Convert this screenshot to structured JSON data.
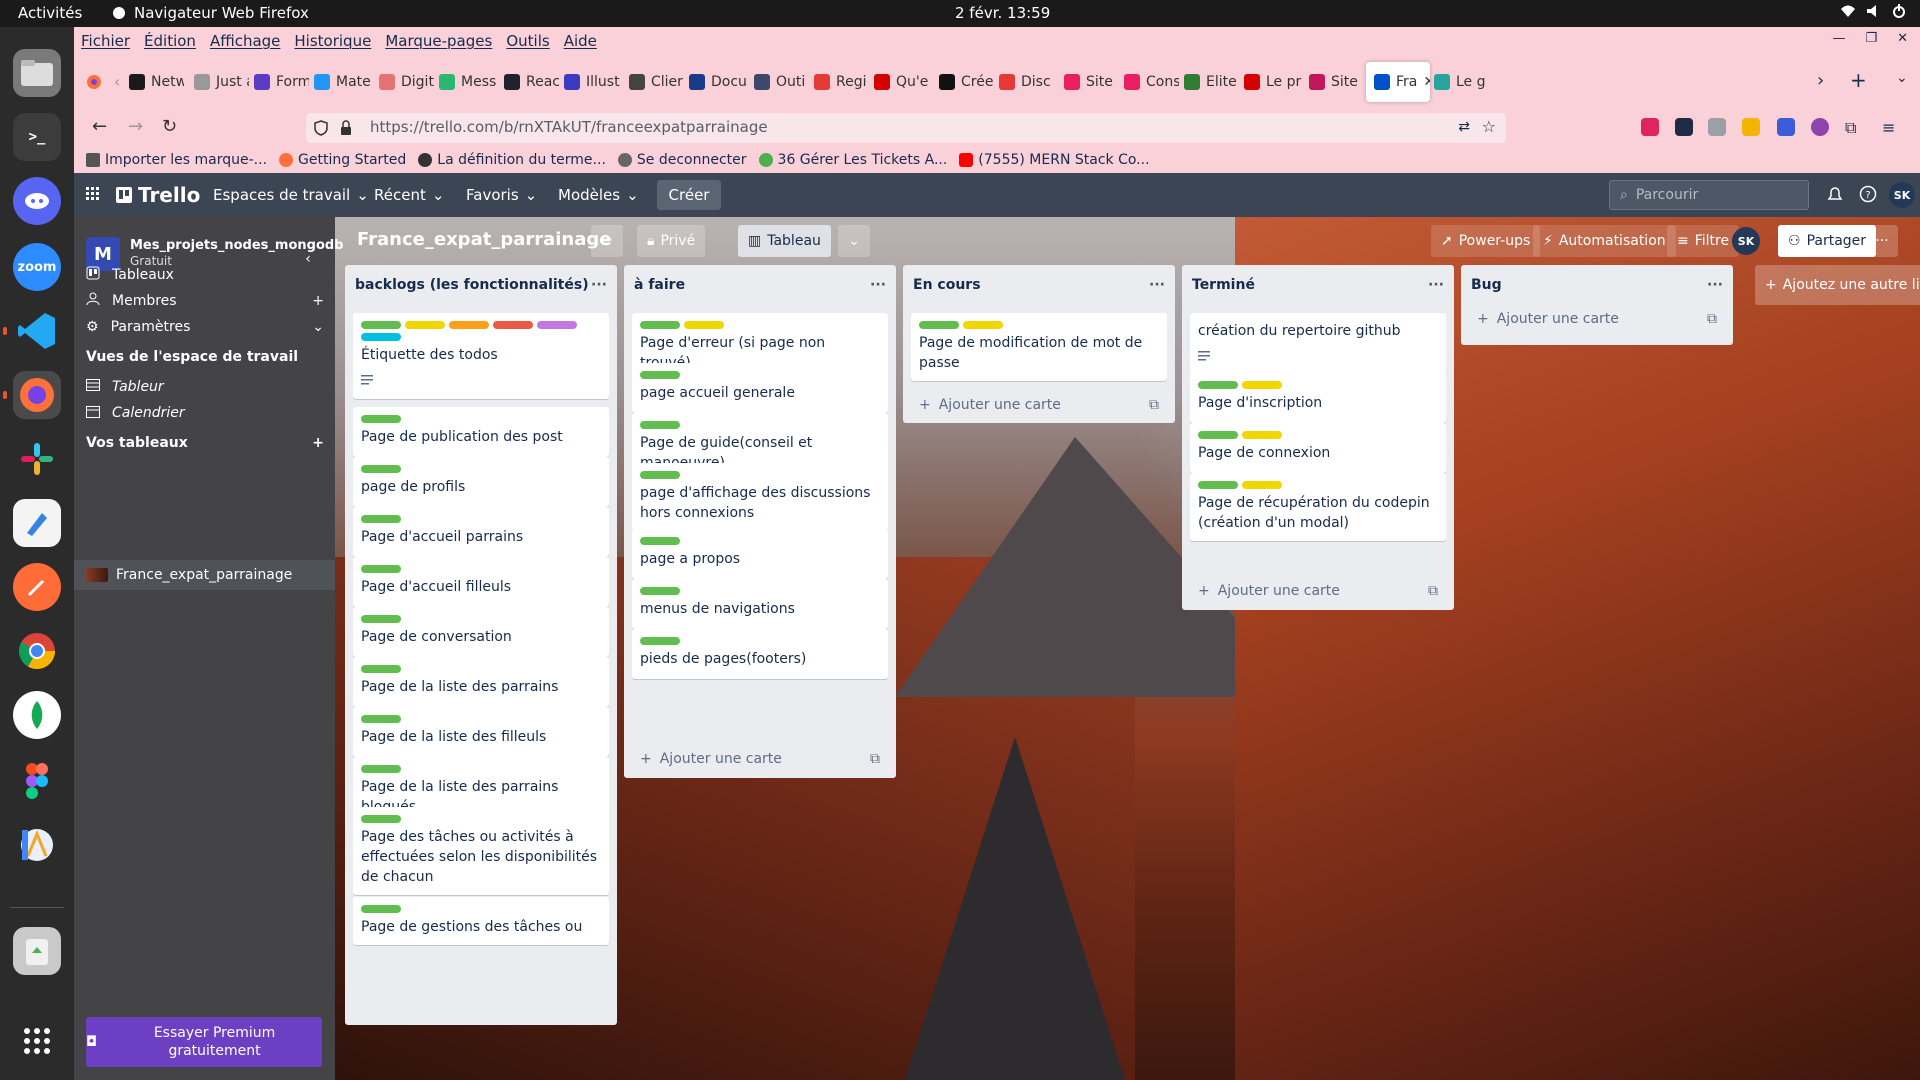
{
  "os": {
    "activities": "Activités",
    "app_name": "Navigateur Web Firefox",
    "clock": "2 févr.  13:59",
    "dock_apps": [
      "files",
      "terminal",
      "discord",
      "zoom",
      "vscode",
      "firefox",
      "slack",
      "text-editor",
      "postman",
      "chrome",
      "mongodb-compass",
      "figma",
      "android-studio",
      "trash",
      "app-grid"
    ]
  },
  "firefox": {
    "menu": [
      "Fichier",
      "Édition",
      "Affichage",
      "Historique",
      "Marque-pages",
      "Outils",
      "Aide"
    ],
    "tabs": [
      {
        "title": "Netw",
        "color": "#1a1a1a"
      },
      {
        "title": "Just a m",
        "color": "#999999"
      },
      {
        "title": "Form",
        "color": "#5b3cc4"
      },
      {
        "title": "Mate",
        "color": "#2196f3"
      },
      {
        "title": "Digit",
        "color": "#e57373"
      },
      {
        "title": "Mess",
        "color": "#2bb673"
      },
      {
        "title": "Reac",
        "color": "#20232a"
      },
      {
        "title": "Illust",
        "color": "#3b3bbf"
      },
      {
        "title": "Clier",
        "color": "#444444"
      },
      {
        "title": "Docu",
        "color": "#1b3a8a"
      },
      {
        "title": "Outi",
        "color": "#3b4a6b"
      },
      {
        "title": "Regi",
        "color": "#e53935"
      },
      {
        "title": "Qu'e",
        "color": "#d50000"
      },
      {
        "title": "Crée",
        "color": "#111111"
      },
      {
        "title": "Disc",
        "color": "#e53935"
      },
      {
        "title": "Site",
        "color": "#e91e63"
      },
      {
        "title": "Cons",
        "color": "#e91e63"
      },
      {
        "title": "Elite",
        "color": "#2e7d32"
      },
      {
        "title": "Le pr",
        "color": "#d50000"
      },
      {
        "title": "Site",
        "color": "#c2185b"
      },
      {
        "title": "Fra",
        "color": "#0052cc",
        "active": true
      },
      {
        "title": "Le g",
        "color": "#26a69a"
      }
    ],
    "url": "https://trello.com/b/rnXTAkUT/franceexpatparrainage",
    "bookmarks": [
      {
        "label": "Importer les marque-...",
        "color": "#555555"
      },
      {
        "label": "Getting Started",
        "color": "#ff7139"
      },
      {
        "label": "La définition du terme...",
        "color": "#333333"
      },
      {
        "label": "Se deconnecter",
        "color": "#666666"
      },
      {
        "label": "36 Gérer Les Tickets A...",
        "color": "#4caf50"
      },
      {
        "label": "(7555) MERN Stack Co...",
        "color": "#ff0000"
      }
    ]
  },
  "trello": {
    "logo": "Trello",
    "menus": [
      "Espaces de travail",
      "Récent",
      "Favoris",
      "Modèles"
    ],
    "create": "Créer",
    "search_placeholder": "Parcourir",
    "avatar": "SK",
    "workspace": {
      "name": "Mes_projets_nodes_mongodb",
      "plan": "Gratuit",
      "initial": "M"
    },
    "sidebar": {
      "items": [
        "Tableaux",
        "Membres",
        "Paramètres"
      ],
      "views_title": "Vues de l'espace de travail",
      "views": [
        "Tableur",
        "Calendrier"
      ],
      "boards_title": "Vos tableaux",
      "boards": [
        "France_expat_parrainage"
      ],
      "premium": "Essayer Premium gratuitement"
    },
    "board": {
      "title": "France_expat_parrainage",
      "visibility": "Privé",
      "view": "Tableau",
      "powerups": "Power-ups",
      "automation": "Automatisation",
      "filter": "Filtre",
      "share": "Partager",
      "add_list": "Ajoutez une autre liste"
    },
    "add_card": "Ajouter une carte",
    "label_colors": {
      "green": "#61bd4f",
      "yellow": "#f2d600",
      "orange": "#ff9f1a",
      "red": "#eb5a46",
      "purple": "#c377e0",
      "blue": "#0079bf",
      "sky": "#00c2e0"
    },
    "lists": [
      {
        "title": "backlogs (les fonctionnalités)",
        "cards": [
          {
            "title": "Étiquette des todos",
            "labels": [
              "green",
              "yellow",
              "orange",
              "red",
              "purple",
              "sky"
            ],
            "description": true
          },
          {
            "title": "Page de publication des post",
            "labels": [
              "green"
            ]
          },
          {
            "title": "page de profils",
            "labels": [
              "green"
            ]
          },
          {
            "title": "Page d'accueil parrains",
            "labels": [
              "green"
            ]
          },
          {
            "title": "Page d'accueil filleuls",
            "labels": [
              "green"
            ]
          },
          {
            "title": "Page de conversation",
            "labels": [
              "green"
            ]
          },
          {
            "title": "Page de la liste des parrains",
            "labels": [
              "green"
            ]
          },
          {
            "title": "Page de la liste des filleuls",
            "labels": [
              "green"
            ]
          },
          {
            "title": "Page de la liste des parrains bloqués",
            "labels": [
              "green"
            ]
          },
          {
            "title": "Page des tâches ou activités à effectuées selon les disponibilités de chacun",
            "labels": [
              "green"
            ]
          },
          {
            "title": "Page de gestions des tâches ou",
            "labels": [
              "green"
            ]
          }
        ]
      },
      {
        "title": "à faire",
        "cards": [
          {
            "title": "Page d'erreur (si page non trouvé)",
            "labels": [
              "green",
              "yellow"
            ]
          },
          {
            "title": "page accueil generale",
            "labels": [
              "green"
            ]
          },
          {
            "title": "Page de guide(conseil et manoeuvre)",
            "labels": [
              "green"
            ]
          },
          {
            "title": "page d'affichage des discussions hors connexions",
            "labels": [
              "green"
            ]
          },
          {
            "title": "page a propos",
            "labels": [
              "green"
            ]
          },
          {
            "title": "menus de navigations",
            "labels": [
              "green"
            ]
          },
          {
            "title": "pieds de pages(footers)",
            "labels": [
              "green"
            ]
          }
        ]
      },
      {
        "title": "En cours",
        "cards": [
          {
            "title": "Page de modification de mot de passe",
            "labels": [
              "green",
              "yellow"
            ]
          }
        ]
      },
      {
        "title": "Terminé",
        "cards": [
          {
            "title": "création du repertoire github",
            "labels": [],
            "description": true
          },
          {
            "title": "Page d'inscription",
            "labels": [
              "green",
              "yellow"
            ]
          },
          {
            "title": "Page de connexion",
            "labels": [
              "green",
              "yellow"
            ]
          },
          {
            "title": "Page de récupération du codepin (création d'un modal)",
            "labels": [
              "green",
              "yellow"
            ]
          }
        ]
      },
      {
        "title": "Bug",
        "cards": []
      }
    ]
  }
}
